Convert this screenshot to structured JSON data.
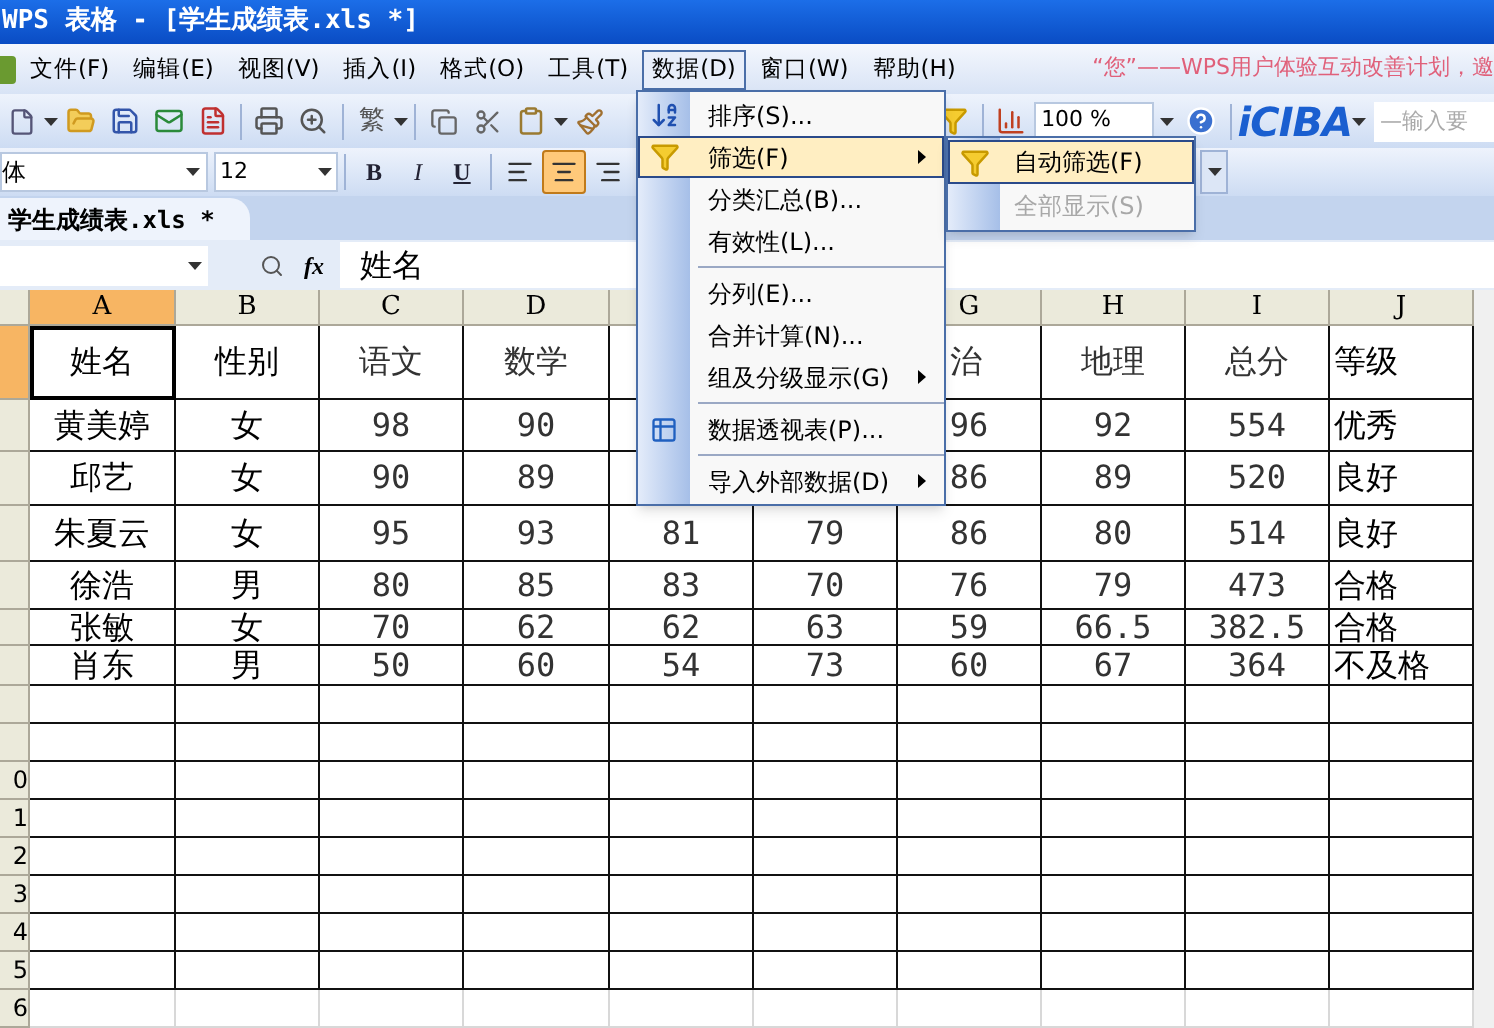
{
  "window": {
    "title": "WPS 表格 - [学生成绩表.xls *]"
  },
  "menu_bar": {
    "items": [
      {
        "label": "文件(F)",
        "selected": false
      },
      {
        "label": "编辑(E)",
        "selected": false
      },
      {
        "label": "视图(V)",
        "selected": false
      },
      {
        "label": "插入(I)",
        "selected": false
      },
      {
        "label": "格式(O)",
        "selected": false
      },
      {
        "label": "工具(T)",
        "selected": false
      },
      {
        "label": "数据(D)",
        "selected": true
      },
      {
        "label": "窗口(W)",
        "selected": false
      },
      {
        "label": "帮助(H)",
        "selected": false
      }
    ],
    "notice": "“您”——WPS用户体验互动改善计划，邀"
  },
  "standard_toolbar": {
    "traditional": "繁",
    "zoom": "100 %",
    "logo": "iCIBA",
    "search": {
      "placeholder": "—输入要"
    }
  },
  "format_toolbar": {
    "font": "体",
    "size": "12",
    "styles": [
      {
        "label": "B",
        "selected": false
      },
      {
        "label": "I",
        "selected": false
      },
      {
        "label": "U",
        "selected": false
      }
    ],
    "alignment": [
      {
        "kind": "left",
        "selected": false
      },
      {
        "kind": "center",
        "selected": true
      },
      {
        "kind": "right",
        "selected": false
      }
    ]
  },
  "sheet_tabs": [
    {
      "label": "学生成绩表.xls *",
      "selected": true
    }
  ],
  "formula_bar": {
    "function_label": "fx",
    "value": "姓名"
  },
  "sheet": {
    "columns": [
      {
        "label": "A",
        "selected": true
      },
      {
        "label": "B",
        "selected": false
      },
      {
        "label": "C",
        "selected": false
      },
      {
        "label": "D",
        "selected": false
      },
      null,
      null,
      {
        "label": "G",
        "selected": false
      },
      {
        "label": "H",
        "selected": false
      },
      {
        "label": "I",
        "selected": false
      },
      {
        "label": "J",
        "selected": false
      }
    ],
    "rows": [
      {
        "selected": true,
        "cells": [
          "姓名",
          "性别",
          "语文",
          "数学",
          null,
          null,
          "治",
          "地理",
          "总分",
          "等级"
        ]
      },
      {
        "selected": false,
        "cells": [
          "黄美婷",
          "女",
          "98",
          "90",
          null,
          null,
          "96",
          "92",
          "554",
          "优秀"
        ]
      },
      {
        "selected": false,
        "cells": [
          "邱艺",
          "女",
          "90",
          "89",
          null,
          null,
          "86",
          "89",
          "520",
          "良好"
        ]
      },
      {
        "selected": false,
        "cells": [
          "朱夏云",
          "女",
          "95",
          "93",
          "81",
          "79",
          "86",
          "80",
          "514",
          "良好"
        ]
      },
      {
        "selected": false,
        "cells": [
          "徐浩",
          "男",
          "80",
          "85",
          "83",
          "70",
          "76",
          "79",
          "473",
          "合格"
        ]
      },
      {
        "selected": false,
        "cells": [
          "张敏",
          "女",
          "70",
          "62",
          "62",
          "63",
          "59",
          "66.5",
          "382.5",
          "合格"
        ]
      },
      {
        "selected": false,
        "cells": [
          "肖东",
          "男",
          "50",
          "60",
          "54",
          "73",
          "60",
          "67",
          "364",
          "不及格"
        ]
      },
      {
        "selected": false,
        "cells": []
      },
      {
        "selected": false,
        "cells": []
      },
      {
        "header": "0",
        "selected": false,
        "cells": []
      },
      {
        "header": "1",
        "selected": false,
        "cells": []
      },
      {
        "header": "2",
        "selected": false,
        "cells": []
      },
      {
        "header": "3",
        "selected": false,
        "cells": []
      },
      {
        "header": "4",
        "selected": false,
        "cells": []
      },
      {
        "header": "5",
        "selected": false,
        "cells": []
      },
      {
        "header": "6",
        "selected": false,
        "cells": []
      }
    ]
  },
  "data_menu": {
    "items": [
      {
        "kind": "item",
        "label": "排序(S)...",
        "selected": false,
        "submenu": false
      },
      {
        "kind": "item",
        "label": "筛选(F)",
        "selected": true,
        "submenu": true
      },
      {
        "kind": "item",
        "label": "分类汇总(B)...",
        "selected": false,
        "submenu": false
      },
      {
        "kind": "item",
        "label": "有效性(L)...",
        "selected": false,
        "submenu": false
      },
      {
        "kind": "separator"
      },
      {
        "kind": "item",
        "label": "分列(E)...",
        "selected": false,
        "submenu": false
      },
      {
        "kind": "item",
        "label": "合并计算(N)...",
        "selected": false,
        "submenu": false
      },
      {
        "kind": "item",
        "label": "组及分级显示(G)",
        "selected": false,
        "submenu": true
      },
      {
        "kind": "separator"
      },
      {
        "kind": "item",
        "label": "数据透视表(P)...",
        "selected": false,
        "submenu": false
      },
      {
        "kind": "separator"
      },
      {
        "kind": "item",
        "label": "导入外部数据(D)",
        "selected": false,
        "submenu": true
      }
    ]
  },
  "filter_submenu": {
    "items": [
      {
        "label": "自动筛选(F)",
        "selected": true,
        "disabled": false
      },
      {
        "label": "全部显示(S)",
        "selected": false,
        "disabled": true
      }
    ]
  }
}
